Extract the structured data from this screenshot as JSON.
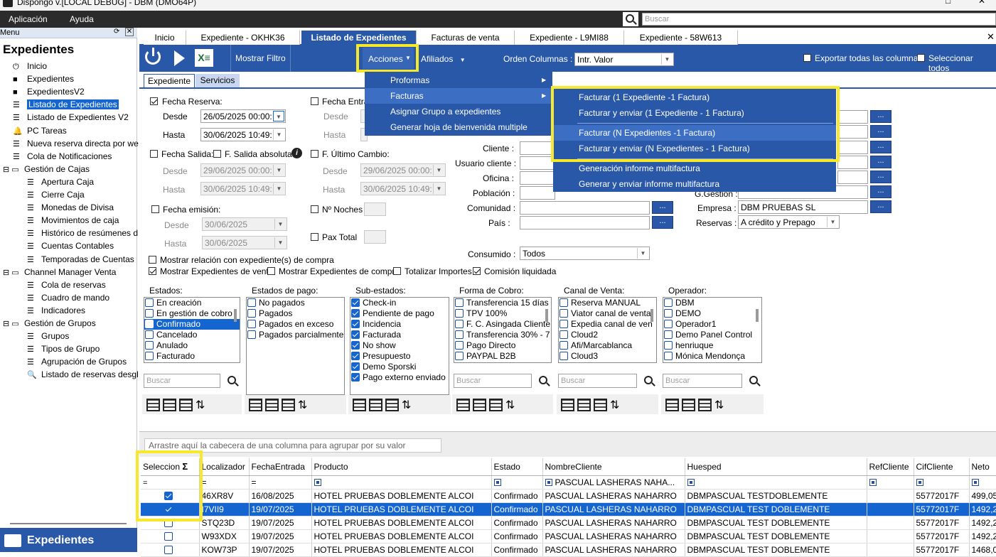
{
  "window": {
    "title": "Dispongo v.[LOCAL DEBUG] - DBM (DMO64P)"
  },
  "menubar": {
    "items": [
      "Aplicación",
      "Ayuda"
    ],
    "search_placeholder": "Buscar"
  },
  "sidebar": {
    "header": "Menu",
    "title": "Expedientes",
    "items": [
      {
        "label": "Inicio",
        "icon": "power-icon"
      },
      {
        "label": "Expedientes",
        "icon": "folder-icon"
      },
      {
        "label": "ExpedientesV2",
        "icon": "folder-icon"
      },
      {
        "label": "Listado de Expedientes",
        "icon": "list-icon"
      },
      {
        "label": "Listado de Expedientes V2",
        "icon": "list-icon"
      },
      {
        "label": "PC Tareas",
        "icon": "bell-icon"
      },
      {
        "label": "Nueva reserva directa por we",
        "icon": "list-icon"
      },
      {
        "label": "Cola de Notificaciones",
        "icon": "list-icon"
      },
      {
        "label": "Gestión de Cajas",
        "icon": "folder-open-icon"
      },
      {
        "label": "Apertura Caja",
        "icon": "list-icon"
      },
      {
        "label": "Cierre Caja",
        "icon": "list-icon"
      },
      {
        "label": "Monedas de Divisa",
        "icon": "list-icon"
      },
      {
        "label": "Movimientos de caja",
        "icon": "list-icon"
      },
      {
        "label": "Histórico de resúmenes d",
        "icon": "list-icon"
      },
      {
        "label": "Cuentas Contables",
        "icon": "list-icon"
      },
      {
        "label": "Temporadas de Cuentas",
        "icon": "list-icon"
      },
      {
        "label": "Channel Manager Venta",
        "icon": "folder-open-icon"
      },
      {
        "label": "Cola de reservas",
        "icon": "list-icon"
      },
      {
        "label": "Cuadro de mando",
        "icon": "list-icon"
      },
      {
        "label": "Indicadores",
        "icon": "list-icon"
      },
      {
        "label": "Gestión de Grupos",
        "icon": "folder-open-icon"
      },
      {
        "label": "Grupos",
        "icon": "list-icon"
      },
      {
        "label": "Tipos de Grupo",
        "icon": "list-icon"
      },
      {
        "label": "Agrupación de Grupos",
        "icon": "list-icon"
      },
      {
        "label": "Listado de reservas desgl",
        "icon": "doc-search-icon"
      }
    ],
    "footer": "Expedientes"
  },
  "tabs": [
    "Inicio",
    "Expediente  - OKHK36",
    "Listado de Expedientes",
    "Facturas de venta",
    "Expediente  - L9MI88",
    "Expediente  - 58W613"
  ],
  "toolbar": {
    "mostrar_filtro": "Mostrar Filtro",
    "acciones": "Acciones",
    "afiliados": "Afiliados",
    "orden_label": "Orden Columnas :",
    "orden_value": "Intr. Valor",
    "exportar": "Exportar todas las columnas",
    "seleccionar": "Seleccionar todos"
  },
  "subtabs": [
    "Expediente",
    "Servicios"
  ],
  "filters": {
    "fecha_reserva": "Fecha Reserva:",
    "desde": "Desde",
    "hasta": "Hasta",
    "fr_desde": "26/05/2025 00:00:",
    "fr_hasta": "30/06/2025 10:49:",
    "fecha_entrada": "Fecha Entrad",
    "fecha_salida": "Fecha Salida:",
    "f_salida_abs": "F. Salida absoluta",
    "fs_desde": "29/06/2025 00:00:",
    "fs_hasta": "30/06/2025 10:49:",
    "f_ultimo": "F. Último Cambio:",
    "fu_desde": "29/06/2025 00:00:",
    "fu_hasta": "30/06/2025 10:49:",
    "fecha_emision": "Fecha emisión:",
    "fe_desde": "30/06/2025",
    "fe_hasta": "30/06/2025",
    "noches": "Nº Noches",
    "pax": "Pax Total",
    "cliente": "Cliente :",
    "usuario": "Usuario cliente :",
    "oficina": "Oficina :",
    "poblacion": "Población :",
    "comunidad": "Comunidad :",
    "pais": "País :",
    "empresa_label": "Empresa :",
    "empresa_value": "DBM PRUEBAS SL",
    "reservas_label": "Reservas :",
    "reservas_value": "A crédito y Prepago",
    "gestion_label": "G.Gestión :",
    "consumido_label": "Consumido :",
    "consumido_value": "Todos",
    "mostrar_relacion": "Mostrar relación con expediente(s) de compra",
    "mostrar_venta": "Mostrar Expedientes de venta",
    "mostrar_compra": "Mostrar Expedientes de compra",
    "totalizar": "Totalizar Importes",
    "comision": "Comisión liquidada"
  },
  "lists": [
    {
      "title": "Estados:",
      "items": [
        {
          "label": "En creación",
          "checked": false
        },
        {
          "label": "En gestión de cobro",
          "checked": false
        },
        {
          "label": "Confirmado",
          "checked": true,
          "selected": true
        },
        {
          "label": "Cancelado",
          "checked": false
        },
        {
          "label": "Anulado",
          "checked": false
        },
        {
          "label": "Facturado",
          "checked": false
        }
      ]
    },
    {
      "title": "Estados de pago:",
      "items": [
        {
          "label": "No pagados",
          "checked": false
        },
        {
          "label": "Pagados",
          "checked": false
        },
        {
          "label": "Pagados en exceso",
          "checked": false
        },
        {
          "label": "Pagados parcialmente",
          "checked": false
        }
      ]
    },
    {
      "title": "Sub-estados:",
      "items": [
        {
          "label": "Check-in",
          "checked": true
        },
        {
          "label": "Pendiente de pago",
          "checked": true
        },
        {
          "label": "Incidencia",
          "checked": true
        },
        {
          "label": "Facturada",
          "checked": true
        },
        {
          "label": "No show",
          "checked": true
        },
        {
          "label": "Presupuesto",
          "checked": true
        },
        {
          "label": "Demo Sporski",
          "checked": true
        },
        {
          "label": "Pago externo enviado",
          "checked": true
        }
      ]
    },
    {
      "title": "Forma de Cobro:",
      "items": [
        {
          "label": "Transferencia 15 días",
          "checked": false
        },
        {
          "label": "TPV 100%",
          "checked": false
        },
        {
          "label": "F. C. Asingada Cliente",
          "checked": false
        },
        {
          "label": "Transferencia 30% - 7",
          "checked": false
        },
        {
          "label": "Pago Directo",
          "checked": false
        },
        {
          "label": "PAYPAL B2B",
          "checked": false
        }
      ]
    },
    {
      "title": "Canal de Venta:",
      "items": [
        {
          "label": "Reserva MANUAL",
          "checked": false
        },
        {
          "label": "Viator canal de venta",
          "checked": false
        },
        {
          "label": "Expedia canal de ven",
          "checked": false
        },
        {
          "label": "Cloud2",
          "checked": false
        },
        {
          "label": "Afi/Marcablanca",
          "checked": false
        },
        {
          "label": "Cloud3",
          "checked": false
        }
      ]
    },
    {
      "title": "Operador:",
      "items": [
        {
          "label": "DBM",
          "checked": false
        },
        {
          "label": "DEMO",
          "checked": false
        },
        {
          "label": "Operador1",
          "checked": false
        },
        {
          "label": "Demo Panel Control",
          "checked": false
        },
        {
          "label": "henriuque",
          "checked": false
        },
        {
          "label": "Mónica Mendonça",
          "checked": false
        }
      ]
    }
  ],
  "list_search_placeholder": "Buscar",
  "acciones_menu": [
    "Proformas",
    "Facturas",
    "Asignar Grupo a expedientes",
    "Generar hoja de bienvenida multiple"
  ],
  "facturas_submenu": [
    "Facturar (1 Expediente -1 Factura)",
    "Facturar y enviar (1 Expediente - 1 Factura)",
    "Facturar (N Expedientes -1 Factura)",
    "Facturar y enviar (N Expedientes - 1 Factura)",
    "Generación informe multifactura",
    "Generar y enviar informe multifactura"
  ],
  "group_hint": "Arrastre aquí la cabecera de una columna para agrupar por su valor",
  "grid": {
    "columns": [
      "Seleccion",
      "Localizador",
      "FechaEntrada",
      "Producto",
      "Estado",
      "NombreCliente",
      "Huesped",
      "RefCliente",
      "CifCliente",
      "Neto"
    ],
    "filter_nombre": "PASCUAL LASHERAS NAHA...",
    "rows": [
      {
        "sel": true,
        "loc": "46XR8V",
        "fecha": "16/08/2025",
        "prod": "HOTEL PRUEBAS DOBLEMENTE ALCOI",
        "estado": "Confirmado",
        "cliente": "PASCUAL LASHERAS NAHARRO",
        "huesped": "DBMPASCUAL TESTDOBLEMENTE",
        "ref": "",
        "cif": "55772017F",
        "neto": "499,05"
      },
      {
        "sel": true,
        "loc": "I7VII9",
        "fecha": "19/07/2025",
        "prod": "HOTEL PRUEBAS DOBLEMENTE ALCOI",
        "estado": "Confirmado",
        "cliente": "PASCUAL LASHERAS NAHARRO",
        "huesped": "DBMPASCUAL TEST DOBLEMENTE",
        "ref": "",
        "cif": "55772017F",
        "neto": "1492,2"
      },
      {
        "sel": false,
        "loc": "STQ23D",
        "fecha": "19/07/2025",
        "prod": "HOTEL PRUEBAS DOBLEMENTE ALCOI",
        "estado": "Confirmado",
        "cliente": "PASCUAL LASHERAS NAHARRO",
        "huesped": "DBMPASCUAL TEST DOBLEMENTE",
        "ref": "",
        "cif": "55772017F",
        "neto": "1492,2"
      },
      {
        "sel": false,
        "loc": "W93XDX",
        "fecha": "19/07/2025",
        "prod": "HOTEL PRUEBAS DOBLEMENTE ALCOI",
        "estado": "Confirmado",
        "cliente": "PASCUAL LASHERAS NAHARRO",
        "huesped": "DBMPASCUAL TEST DOBLEMENTE",
        "ref": "",
        "cif": "55772017F",
        "neto": "1492,2"
      },
      {
        "sel": false,
        "loc": "KOW73P",
        "fecha": "19/07/2025",
        "prod": "HOTEL PRUEBAS DOBLEMENTE ALCOI",
        "estado": "Confirmado",
        "cliente": "PASCUAL LASHERAS NAHARRO",
        "huesped": "DBMPASCUAL TEST DOBLEMENTE",
        "ref": "",
        "cif": "55772017F",
        "neto": "1468,0"
      }
    ]
  },
  "colors": {
    "accent": "#2a58a8",
    "highlight": "#f7e82b",
    "selection": "#1565d0"
  }
}
